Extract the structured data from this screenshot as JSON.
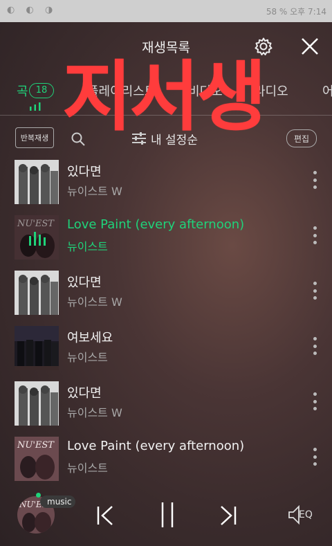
{
  "status_bar": {
    "right_text": "58 % 오후 7:14"
  },
  "header": {
    "title": "재생목록",
    "settings_icon": "gear-icon",
    "close_icon": "close-icon"
  },
  "tabs": [
    {
      "label": "곡",
      "badge": "18"
    },
    {
      "label": "플레이리스트"
    },
    {
      "label": "비디오"
    },
    {
      "label": "라디오"
    },
    {
      "label": "어"
    }
  ],
  "toolbar": {
    "repeat_label": "반복재생",
    "sort_label": "내 설정순",
    "edit_label": "편집"
  },
  "songs": [
    {
      "title": "있다면",
      "artist": "뉴이스트 W"
    },
    {
      "title": "Love Paint (every afternoon)",
      "artist": "뉴이스트",
      "playing": true
    },
    {
      "title": "있다면",
      "artist": "뉴이스트 W"
    },
    {
      "title": "여보세요",
      "artist": "뉴이스트"
    },
    {
      "title": "있다면",
      "artist": "뉴이스트 W"
    },
    {
      "title": "Love Paint (every afternoon)",
      "artist": "뉴이스트"
    }
  ],
  "player": {
    "tag": "music",
    "eq_label": "EQ"
  },
  "overlay": {
    "text": "지서생"
  },
  "colors": {
    "accent": "#1fd37a",
    "overlay": "#ff3c3c"
  }
}
